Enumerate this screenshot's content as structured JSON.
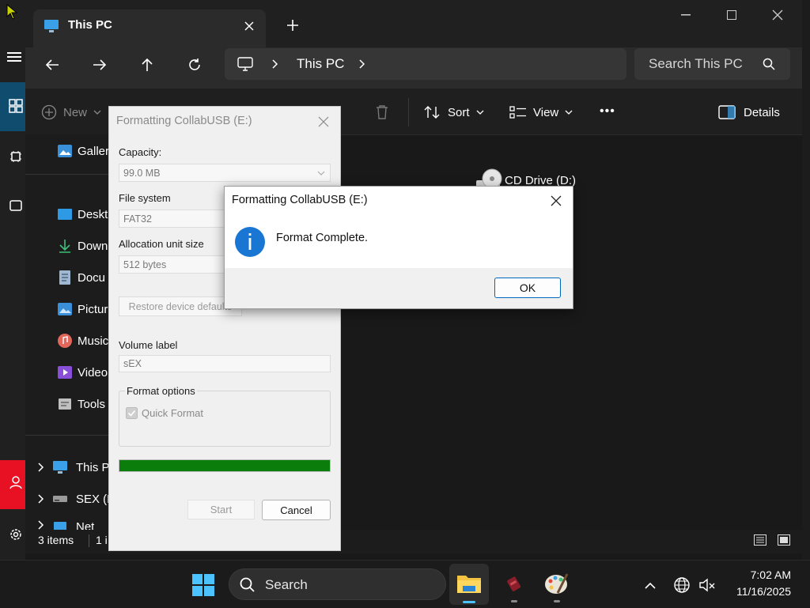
{
  "explorer": {
    "tab_title": "This PC",
    "breadcrumb": "This PC",
    "search_placeholder": "Search This PC",
    "cmd": {
      "new": "New",
      "sort": "Sort",
      "view": "View",
      "more": "•••",
      "details": "Details"
    },
    "sidebar": [
      "Galler",
      "Deskt",
      "Down",
      "Docu",
      "Pictur",
      "Music",
      "Video",
      "Tools",
      "This P",
      "SEX (E",
      "Net"
    ],
    "drive_label": "CD Drive (D:)",
    "status_items": "3 items",
    "status_sel": "1 i"
  },
  "format_dialog": {
    "title": "Formatting CollabUSB (E:)",
    "capacity_label": "Capacity:",
    "capacity_value": "99.0 MB",
    "fs_label": "File system",
    "fs_value": "FAT32",
    "alloc_label": "Allocation unit size",
    "alloc_value": "512 bytes",
    "restore_label": "Restore device defaults",
    "volume_label": "Volume label",
    "volume_value": "sEX",
    "options_label": "Format options",
    "quick_format": "Quick Format",
    "progress": 1.0,
    "start_label": "Start",
    "cancel_label": "Cancel"
  },
  "message_dialog": {
    "title": "Formatting CollabUSB (E:)",
    "message": "Format Complete.",
    "ok_label": "OK"
  },
  "taskbar": {
    "search": "Search",
    "time": "7:02 AM",
    "date": "11/16/2025"
  },
  "colors": {
    "progress": "#0a7d0a",
    "info": "#1976d2",
    "accent": "#0067c0"
  }
}
